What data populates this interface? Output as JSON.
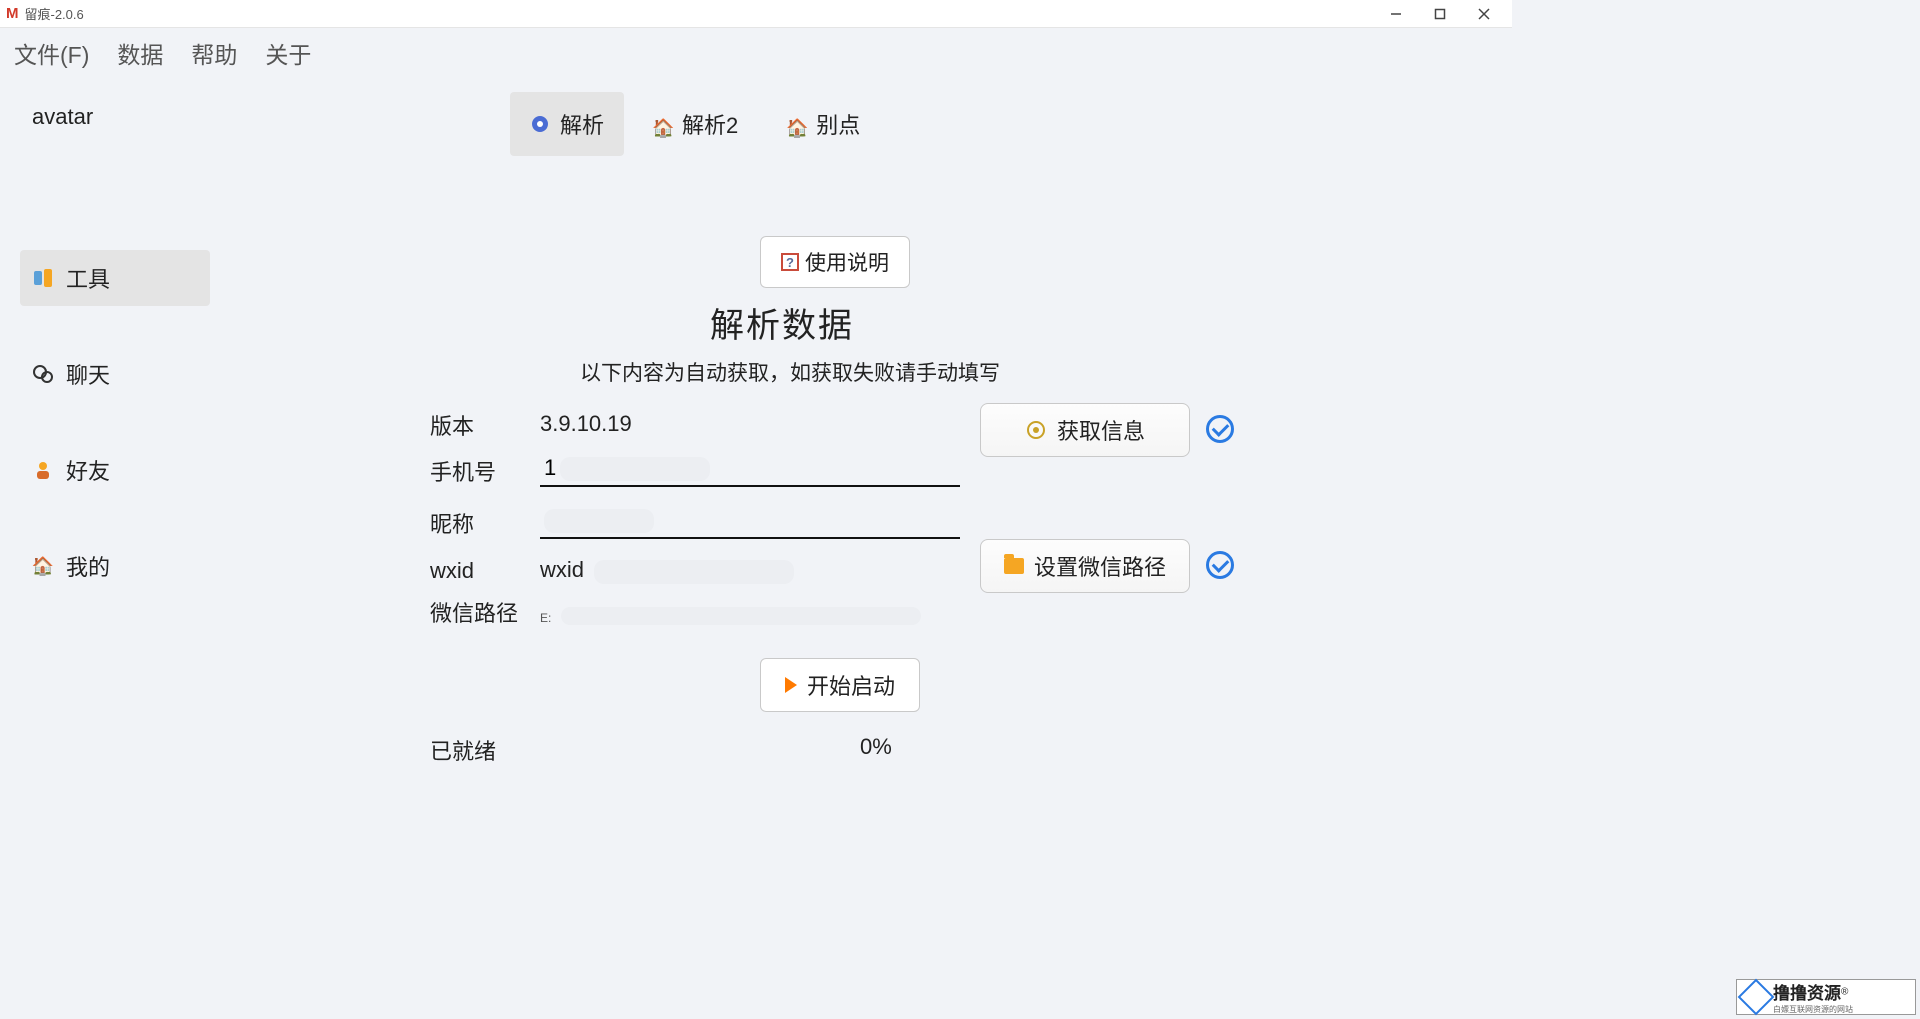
{
  "window": {
    "app_letter": "M",
    "title": "留痕-2.0.6"
  },
  "menubar": {
    "items": [
      "文件(F)",
      "数据",
      "帮助",
      "关于"
    ]
  },
  "sidebar": {
    "avatar_label": "avatar",
    "items": [
      {
        "label": "工具"
      },
      {
        "label": "聊天"
      },
      {
        "label": "好友"
      },
      {
        "label": "我的"
      }
    ]
  },
  "tabs": {
    "items": [
      {
        "label": "解析"
      },
      {
        "label": "解析2"
      },
      {
        "label": "别点"
      }
    ]
  },
  "content": {
    "help_button": "使用说明",
    "section_title": "解析数据",
    "section_subtitle": "以下内容为自动获取，如获取失败请手动填写",
    "form": {
      "version_label": "版本",
      "version_value": "3.9.10.19",
      "phone_label": "手机号",
      "phone_value": "1",
      "nickname_label": "昵称",
      "nickname_value": "",
      "wxid_label": "wxid",
      "wxid_value": "wxid",
      "path_label": "微信路径",
      "path_value": "E:"
    },
    "get_info_button": "获取信息",
    "set_path_button": "设置微信路径",
    "start_button": "开始启动",
    "status_label": "已就绪",
    "progress_text": "0%"
  },
  "watermark": {
    "main": "撸撸资源",
    "reg": "®",
    "sub": "白嫖互联网资源的网站"
  }
}
